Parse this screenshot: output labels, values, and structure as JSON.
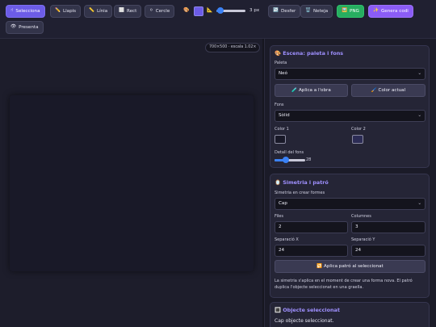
{
  "toolbar": {
    "select": {
      "icon": "☝",
      "label": "Selecciona"
    },
    "pencil": {
      "icon": "✏️",
      "label": "Llapis"
    },
    "line": {
      "icon": "📏",
      "label": "Línia"
    },
    "rect": {
      "icon": "⬜",
      "label": "Rect"
    },
    "circle": {
      "icon": "⚪",
      "label": "Cercle"
    },
    "palette_icon": "🎨",
    "color": "#6c5ce7",
    "width_icon": "📐",
    "stroke_width": 3,
    "stroke_text": "3 px",
    "undo": {
      "icon": "↩️",
      "label": "Desfer"
    },
    "clear": {
      "icon": "🗑️",
      "label": "Neteja"
    },
    "png": {
      "icon": "🖼️",
      "label": "PNG"
    },
    "generate": {
      "icon": "✨",
      "label": "Genera codi"
    },
    "present": {
      "icon": "👁",
      "label": "Presenta"
    }
  },
  "canvas": {
    "info": "700×500 · escala 1.02×",
    "background": "#191928"
  },
  "scene": {
    "icon": "🎨",
    "title": "Escena: paleta i fons",
    "palette_label": "Paleta",
    "palette_value": "Neó",
    "apply_label": "🧪 Aplica a l'obra",
    "current_color_label": "🖌️ Color actual",
    "bg_label": "Fons",
    "bg_value": "Sòlid",
    "color1_label": "Color 1",
    "color1": "#191928",
    "color2_label": "Color 2",
    "color2": "#2c2c55",
    "detail_label": "Detall del fons",
    "detail_value": 28
  },
  "symmetry": {
    "icon": "🪞",
    "title": "Simetria i patró",
    "sym_label": "Simetria en crear formes",
    "sym_value": "Cap",
    "rows_label": "Files",
    "rows_value": "2",
    "cols_label": "Columnes",
    "cols_value": "3",
    "sepx_label": "Separació X",
    "sepx_value": "24",
    "sepy_label": "Separació Y",
    "sepy_value": "24",
    "apply_pattern": "🔁 Aplica patró al seleccionat",
    "note": "La simetria s'aplica en el moment de crear una forma nova. El patró duplica l'objecte seleccionat en una graella."
  },
  "selected": {
    "icon": "🔳",
    "title": "Objecte seleccionat",
    "empty": "Cap objecte seleccionat."
  }
}
